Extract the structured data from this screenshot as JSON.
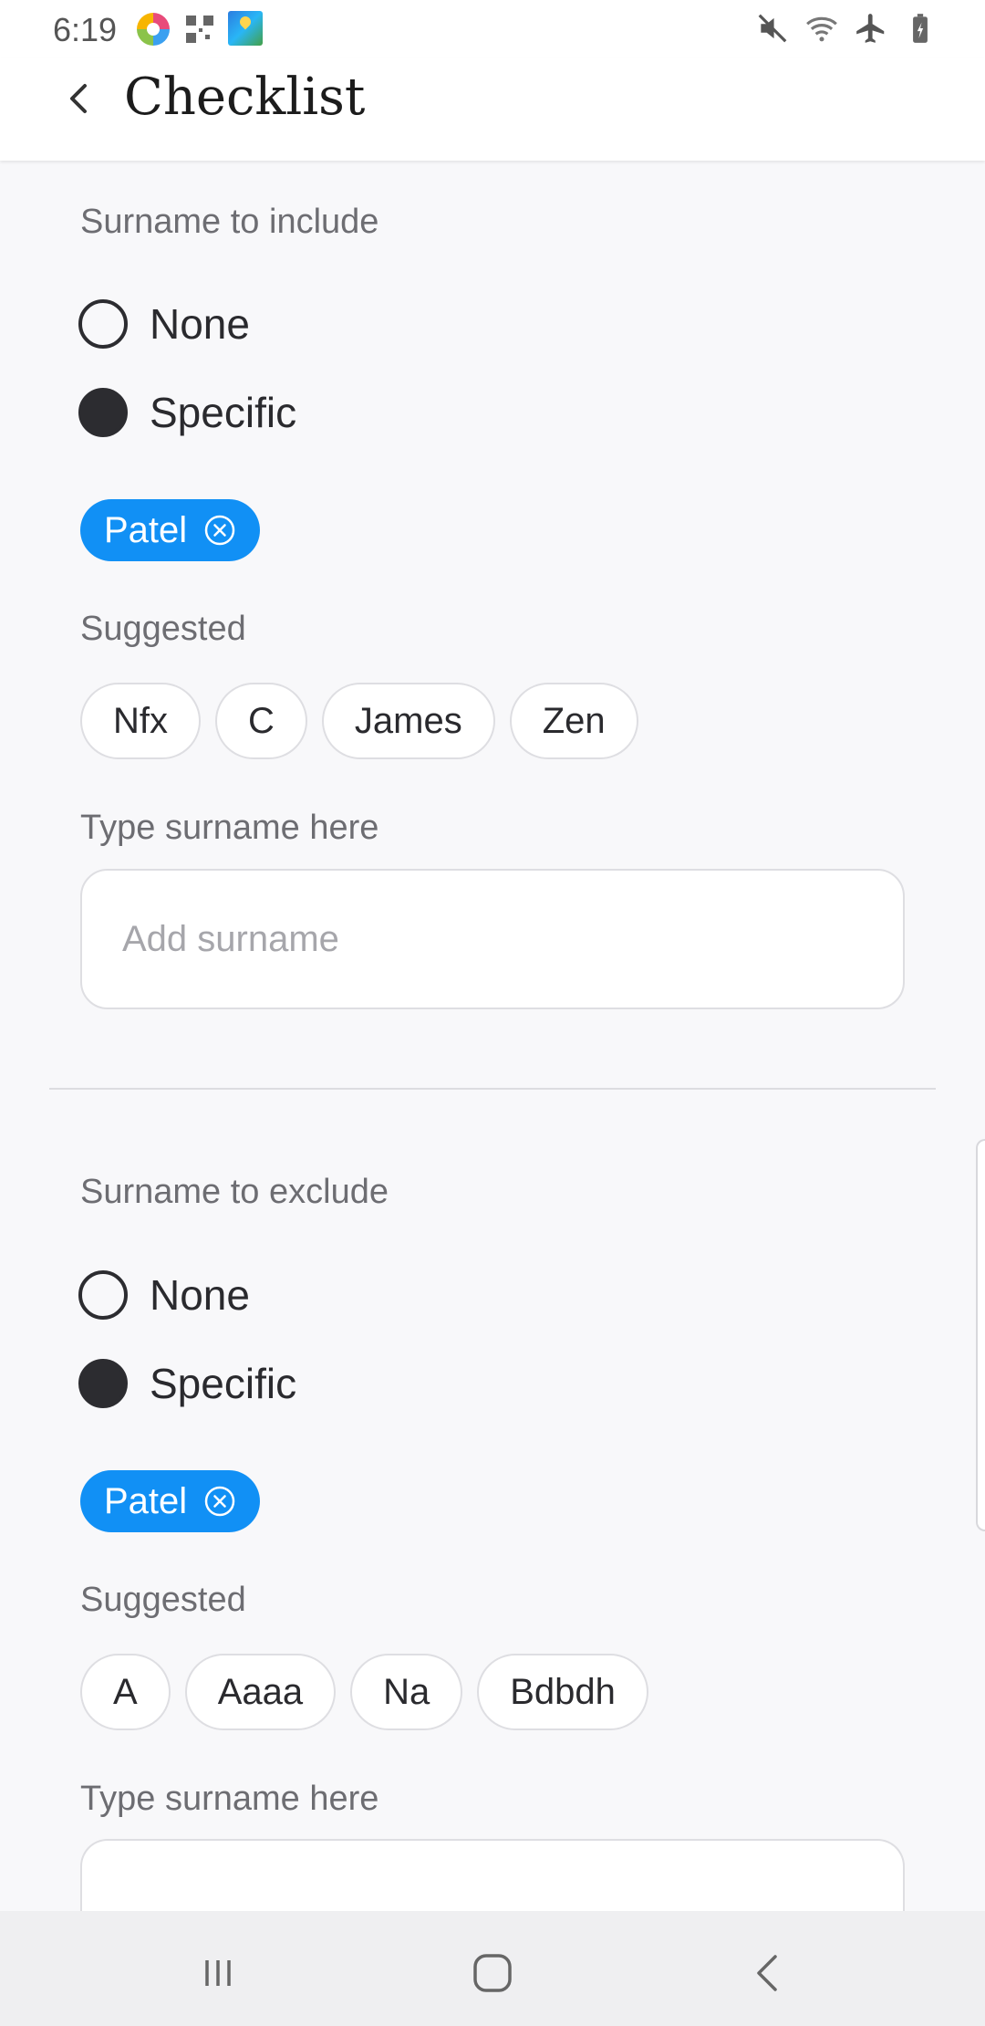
{
  "status_bar": {
    "time": "6:19"
  },
  "header": {
    "title": "Checklist"
  },
  "include": {
    "section_label": "Surname to include",
    "options": [
      "None",
      "Specific"
    ],
    "selected_option": "Specific",
    "selected_chips": [
      "Patel"
    ],
    "suggested_label": "Suggested",
    "suggested": [
      "Nfx",
      "C",
      "James",
      "Zen"
    ],
    "input_label": "Type surname here",
    "input_placeholder": "Add surname",
    "input_value": ""
  },
  "exclude": {
    "section_label": "Surname to exclude",
    "options": [
      "None",
      "Specific"
    ],
    "selected_option": "Specific",
    "selected_chips": [
      "Patel"
    ],
    "suggested_label": "Suggested",
    "suggested": [
      "A",
      "Aaaa",
      "Na",
      "Bdbdh"
    ],
    "input_label": "Type surname here"
  },
  "colors": {
    "accent": "#1190f5",
    "radio": "#2c2c30",
    "background": "#f8f8fa"
  }
}
